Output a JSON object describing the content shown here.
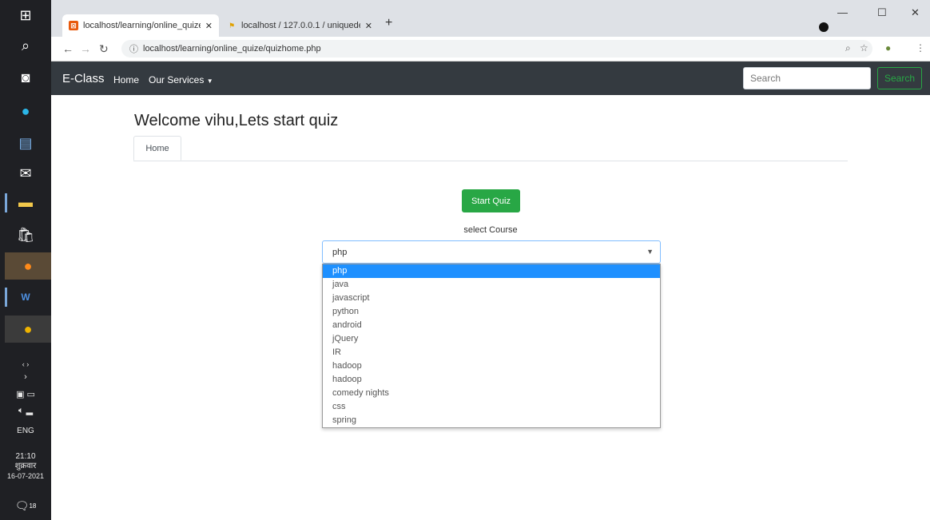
{
  "taskbar": {
    "time": "21:10",
    "day": "शुक्रवार",
    "date": "16-07-2021",
    "lang": "ENG",
    "notif_count": "18"
  },
  "browser": {
    "tabs": [
      {
        "title": "localhost/learning/online_quize/",
        "active": true
      },
      {
        "title": "localhost / 127.0.0.1 / uniquede",
        "active": false
      }
    ],
    "url": "localhost/learning/online_quize/quizhome.php"
  },
  "navbar": {
    "brand": "E-Class",
    "links": [
      "Home",
      "Our Services"
    ],
    "search_placeholder": "Search",
    "search_button": "Search"
  },
  "page": {
    "welcome": "Welcome vihu,Lets start quiz",
    "tab": "Home",
    "start_button": "Start Quiz",
    "course_label": "select Course",
    "selected_course": "php",
    "options": [
      "php",
      "java",
      "javascript",
      "python",
      "android",
      "jQuery",
      "IR",
      "hadoop",
      "hadoop",
      "comedy nights",
      "css",
      "spring"
    ]
  }
}
